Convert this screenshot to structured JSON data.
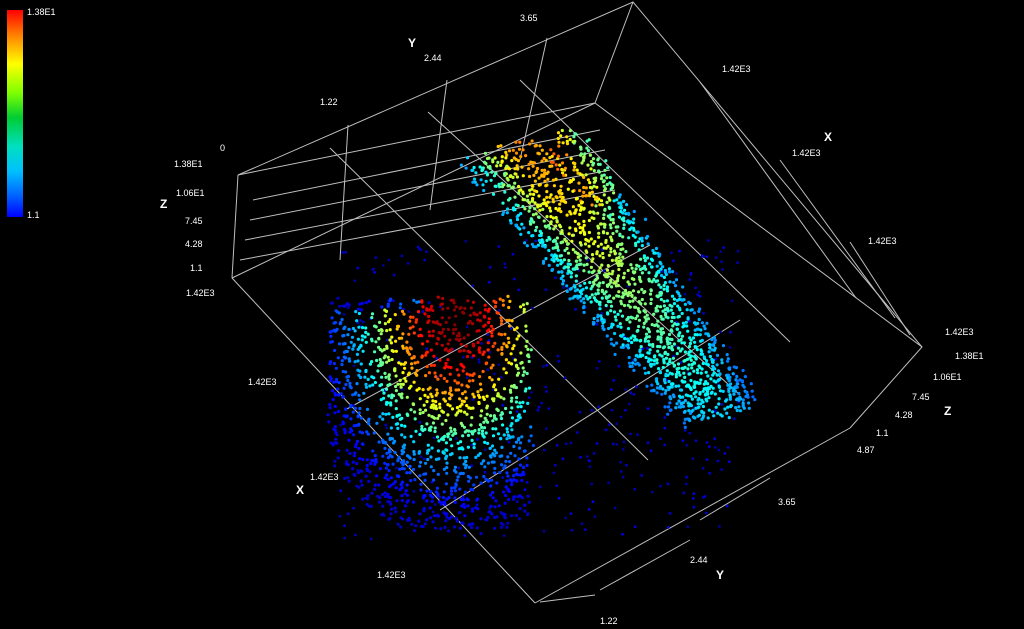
{
  "colorbar": {
    "max_label": "1.38E1",
    "min_label": "1.1"
  },
  "chart_data": {
    "type": "scatter3d",
    "view": "oblique 3D point cloud, colormap jet",
    "axes": {
      "x": {
        "title": "X",
        "ticks": [
          "1.42E3",
          "1.42E3",
          "1.42E3"
        ]
      },
      "y": {
        "title": "Y",
        "ticks": [
          "0",
          "1.22",
          "2.44",
          "3.65",
          "4.87"
        ]
      },
      "z": {
        "title": "Z",
        "ticks": [
          "1.1",
          "4.28",
          "7.45",
          "1.06E1",
          "1.38E1"
        ],
        "range": [
          1.1,
          13.8
        ]
      }
    },
    "axis_labels": {
      "back_y": [
        "0",
        "1.22",
        "2.44",
        "3.65"
      ],
      "left_z": [
        "1.38E1",
        "1.06E1",
        "7.45",
        "4.28",
        "1.1"
      ],
      "left_corner": "1.42E3",
      "left_x": [
        "1.42E3",
        "1.42E3"
      ],
      "bottom_x": "1.42E3",
      "right_x": [
        "1.42E3",
        "1.42E3",
        "1.42E3"
      ],
      "right_z": [
        "1.42E3",
        "1.38E1",
        "1.06E1",
        "7.45",
        "4.28",
        "1.1"
      ],
      "right_corner": "4.87",
      "front_y": [
        "3.65",
        "2.44",
        "1.22"
      ],
      "titles": {
        "x_back": "X",
        "x_front": "X",
        "y_back": "Y",
        "y_front": "Y",
        "z_left": "Z",
        "z_right": "Z"
      }
    },
    "peaks": [
      {
        "name_hint": "left peak",
        "z_max": 13.8
      },
      {
        "name_hint": "right ridge",
        "z_max": 10.6
      }
    ]
  }
}
